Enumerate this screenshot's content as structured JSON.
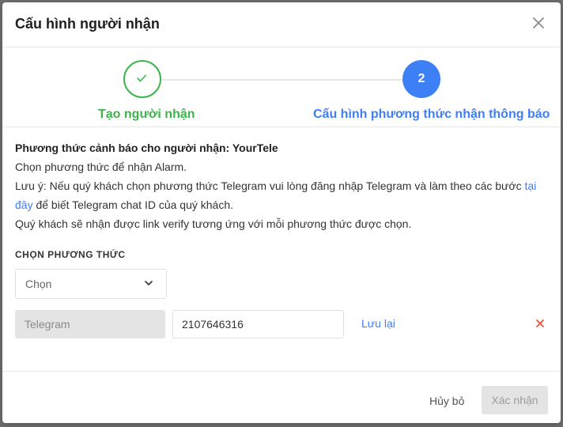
{
  "modal": {
    "title": "Cấu hình người nhận"
  },
  "steps": [
    {
      "label": "Tạo người nhận",
      "status": "done"
    },
    {
      "number": "2",
      "label": "Cấu hình phương thức nhận thông báo",
      "status": "active"
    }
  ],
  "info": {
    "heading": "Phương thức cảnh báo cho người nhận: YourTele",
    "line1": "Chọn phương thức để nhận Alarm.",
    "note_prefix": "Lưu ý: Nếu quý khách chọn phương thức Telegram vui lòng đăng nhập Telegram và làm theo các bước ",
    "note_link_part1": "tại",
    "note_link_part2": "đây",
    "note_suffix": " để biết Telegram chat ID của quý khách.",
    "line3": "Quý khách sẽ nhận được link verify tương ứng với mỗi phương thức được chọn."
  },
  "method": {
    "section_label": "CHỌN PHƯƠNG THỨC",
    "select_value": "Chọn",
    "channel_value": "Telegram",
    "chat_id_value": "2107646316",
    "save_label": "Lưu lại"
  },
  "footer": {
    "cancel_label": "Hủy bỏ",
    "confirm_label": "Xác nhận"
  },
  "colors": {
    "accent": "#3d7ff5",
    "success": "#3cb54a",
    "danger": "#e8543a"
  }
}
